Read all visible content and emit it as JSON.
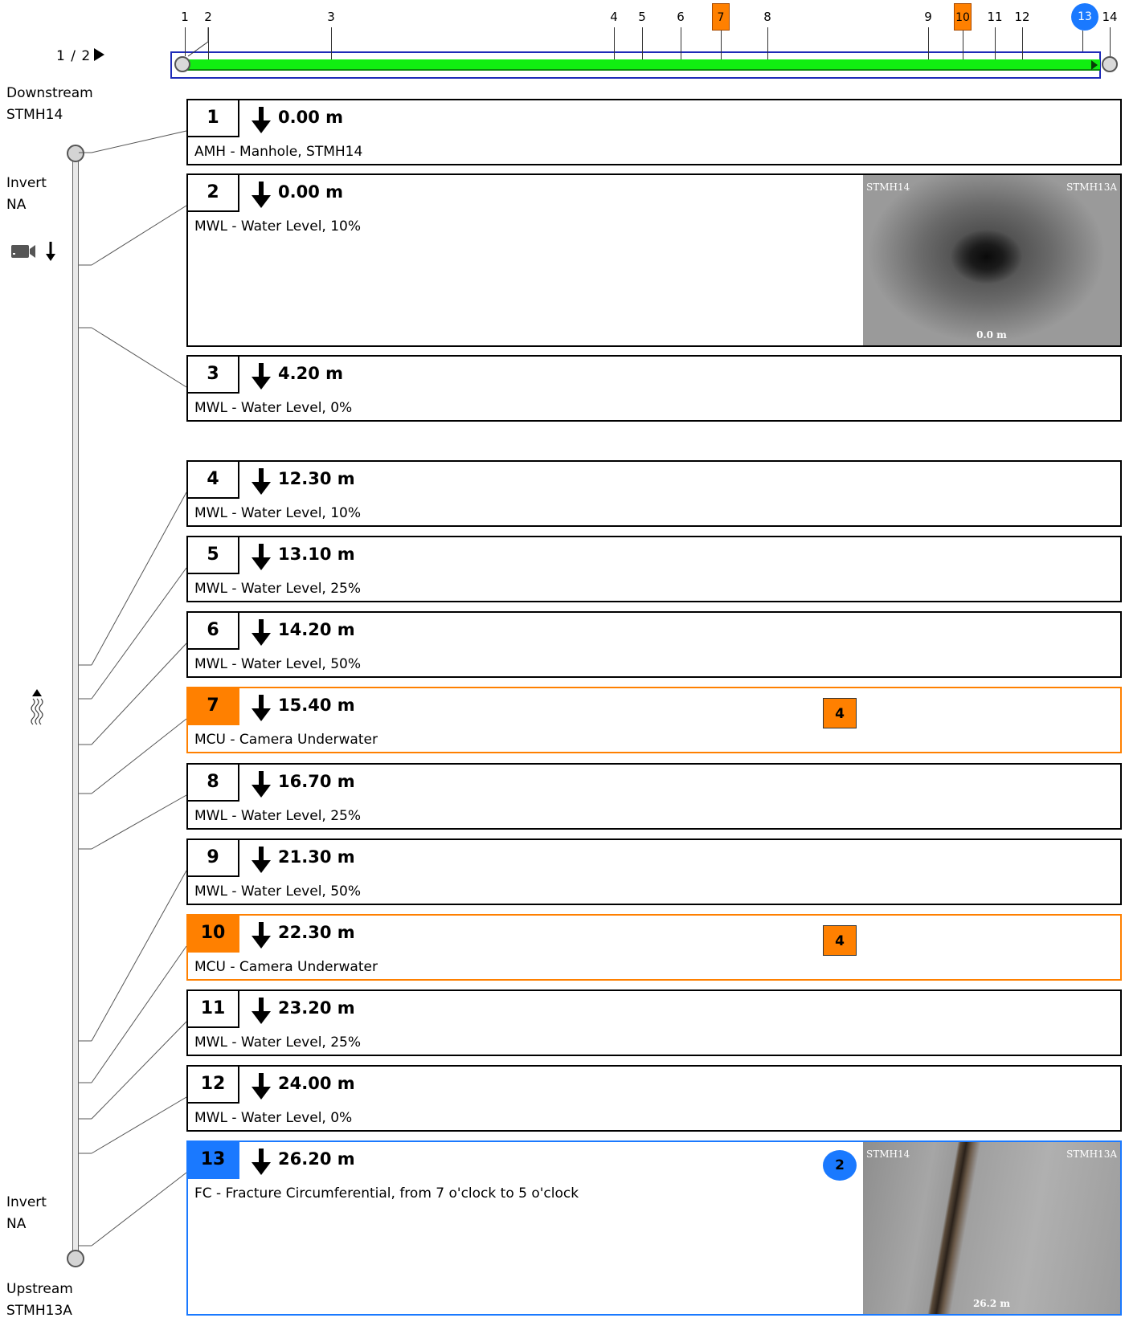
{
  "pager": {
    "label": "1 / 2"
  },
  "overview": {
    "markers": [
      {
        "label": "1",
        "kind": "plain"
      },
      {
        "label": "2",
        "kind": "plain"
      },
      {
        "label": "3",
        "kind": "plain"
      },
      {
        "label": "4",
        "kind": "plain"
      },
      {
        "label": "5",
        "kind": "plain"
      },
      {
        "label": "6",
        "kind": "plain"
      },
      {
        "label": "7",
        "kind": "orange"
      },
      {
        "label": "8",
        "kind": "plain"
      },
      {
        "label": "9",
        "kind": "plain"
      },
      {
        "label": "10",
        "kind": "orange"
      },
      {
        "label": "11",
        "kind": "plain"
      },
      {
        "label": "12",
        "kind": "plain"
      },
      {
        "label": "13",
        "kind": "blue"
      },
      {
        "label": "14",
        "kind": "plain"
      }
    ]
  },
  "side": {
    "downstream_label": "Downstream",
    "downstream_id": "STMH14",
    "invert_top_label": "Invert",
    "invert_top_value": "NA",
    "invert_bottom_label": "Invert",
    "invert_bottom_value": "NA",
    "upstream_label": "Upstream",
    "upstream_id": "STMH13A",
    "camera_icon": "camera-direction-down-icon",
    "flow_icon": "flow-direction-up-icon"
  },
  "colors": {
    "orange": "#ff8000",
    "blue": "#1a79ff",
    "green": "#11ee11",
    "frame_blue": "#1e2bb8"
  },
  "observations": [
    {
      "num": "1",
      "distance": "0.00 m",
      "desc": "AMH - Manhole, STMH14",
      "style": "plain"
    },
    {
      "num": "2",
      "distance": "0.00 m",
      "desc": "MWL - Water Level, 10%",
      "style": "plain",
      "photo": {
        "left_caption": "STMH14",
        "right_caption": "STMH13A",
        "distance": "0.0 m"
      }
    },
    {
      "num": "3",
      "distance": "4.20 m",
      "desc": "MWL - Water Level, 0%",
      "style": "plain"
    },
    {
      "num": "4",
      "distance": "12.30 m",
      "desc": "MWL - Water Level, 10%",
      "style": "plain"
    },
    {
      "num": "5",
      "distance": "13.10 m",
      "desc": "MWL - Water Level, 25%",
      "style": "plain"
    },
    {
      "num": "6",
      "distance": "14.20 m",
      "desc": "MWL - Water Level, 50%",
      "style": "plain"
    },
    {
      "num": "7",
      "distance": "15.40 m",
      "desc": "MCU - Camera Underwater",
      "style": "orange",
      "grade": "4"
    },
    {
      "num": "8",
      "distance": "16.70 m",
      "desc": "MWL - Water Level, 25%",
      "style": "plain"
    },
    {
      "num": "9",
      "distance": "21.30 m",
      "desc": "MWL - Water Level, 50%",
      "style": "plain"
    },
    {
      "num": "10",
      "distance": "22.30 m",
      "desc": "MCU - Camera Underwater",
      "style": "orange",
      "grade": "4"
    },
    {
      "num": "11",
      "distance": "23.20 m",
      "desc": "MWL - Water Level, 25%",
      "style": "plain"
    },
    {
      "num": "12",
      "distance": "24.00 m",
      "desc": "MWL - Water Level, 0%",
      "style": "plain"
    },
    {
      "num": "13",
      "distance": "26.20 m",
      "desc": "FC - Fracture Circumferential, from 7 o'clock to 5 o'clock",
      "style": "blue",
      "grade": "2",
      "photo": {
        "left_caption": "STMH14",
        "right_caption": "STMH13A",
        "distance": "26.2 m"
      }
    }
  ]
}
